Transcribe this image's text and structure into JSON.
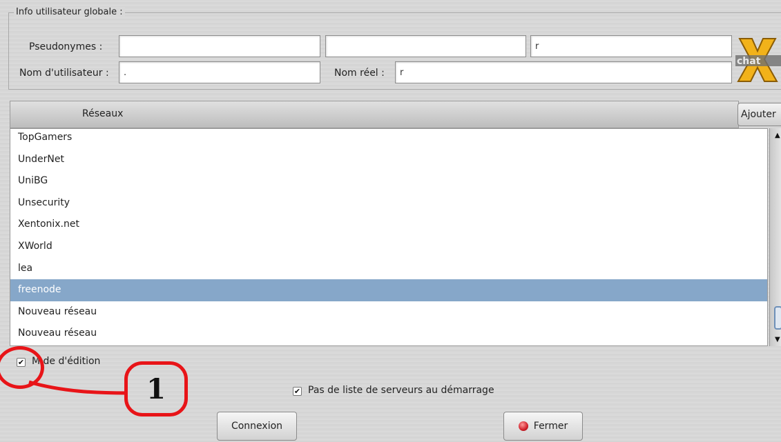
{
  "user_info": {
    "legend": "Info utilisateur globale :",
    "nickname_label": "Pseudonymes :",
    "nick1": "",
    "nick2": "",
    "nick3": "r",
    "username_label": "Nom d'utilisateur :",
    "username": ".",
    "realname_label": "Nom réel :",
    "realname": "r"
  },
  "networks": {
    "header": "Réseaux",
    "add_label": "Ajouter",
    "items": [
      "TopGamers",
      "UnderNet",
      "UniBG",
      "Unsecurity",
      "Xentonix.net",
      "XWorld",
      "lea",
      "freenode",
      "Nouveau réseau",
      "Nouveau réseau"
    ],
    "selected": "freenode"
  },
  "options": {
    "edit_mode_label": "M  de d'édition",
    "no_server_list_label": "Pas de liste de serveurs au démarrage"
  },
  "buttons": {
    "connect_label": "Connexion",
    "close_label": "Fermer"
  },
  "annotation": {
    "number": "1",
    "color": "#e81418"
  },
  "colors": {
    "selection": "#86a7c9"
  }
}
